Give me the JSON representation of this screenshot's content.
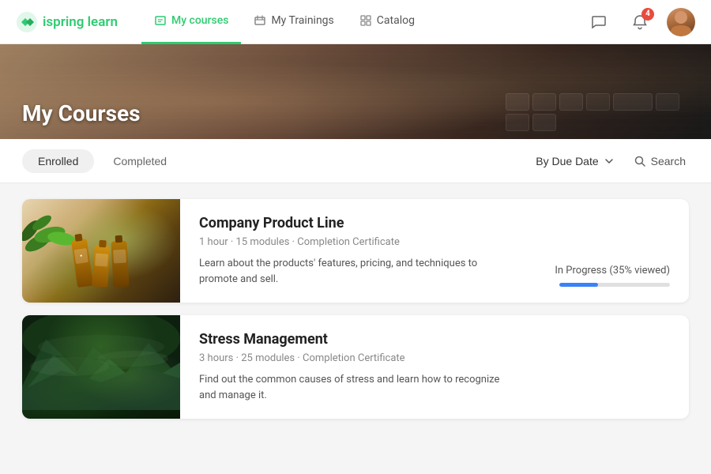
{
  "logo": {
    "brand": "ispring",
    "product": "learn"
  },
  "nav": {
    "links": [
      {
        "id": "my-courses",
        "icon": "courses-icon",
        "label": "My courses",
        "active": true
      },
      {
        "id": "my-trainings",
        "icon": "trainings-icon",
        "label": "My Trainings",
        "active": false
      },
      {
        "id": "catalog",
        "icon": "catalog-icon",
        "label": "Catalog",
        "active": false
      }
    ],
    "notifications_count": "4",
    "avatar_alt": "User avatar"
  },
  "hero": {
    "title": "My Courses"
  },
  "filter_bar": {
    "tabs": [
      {
        "id": "enrolled",
        "label": "Enrolled",
        "active": true
      },
      {
        "id": "completed",
        "label": "Completed",
        "active": false
      }
    ],
    "sort": {
      "label": "By Due Date"
    },
    "search": {
      "label": "Search"
    }
  },
  "courses": [
    {
      "id": "company-product-line",
      "title": "Company Product Line",
      "meta": "1 hour · 15 modules · Completion Certificate",
      "description": "Learn about the products' features, pricing, and techniques to promote and sell.",
      "status": "In Progress (35% viewed)",
      "progress": 35,
      "thumbnail_type": "products"
    },
    {
      "id": "stress-management",
      "title": "Stress Management",
      "meta": "3 hours · 25 modules · Completion Certificate",
      "description": "Find out the common causes of stress and learn how to recognize and manage it.",
      "status": null,
      "progress": null,
      "thumbnail_type": "mountains"
    }
  ]
}
